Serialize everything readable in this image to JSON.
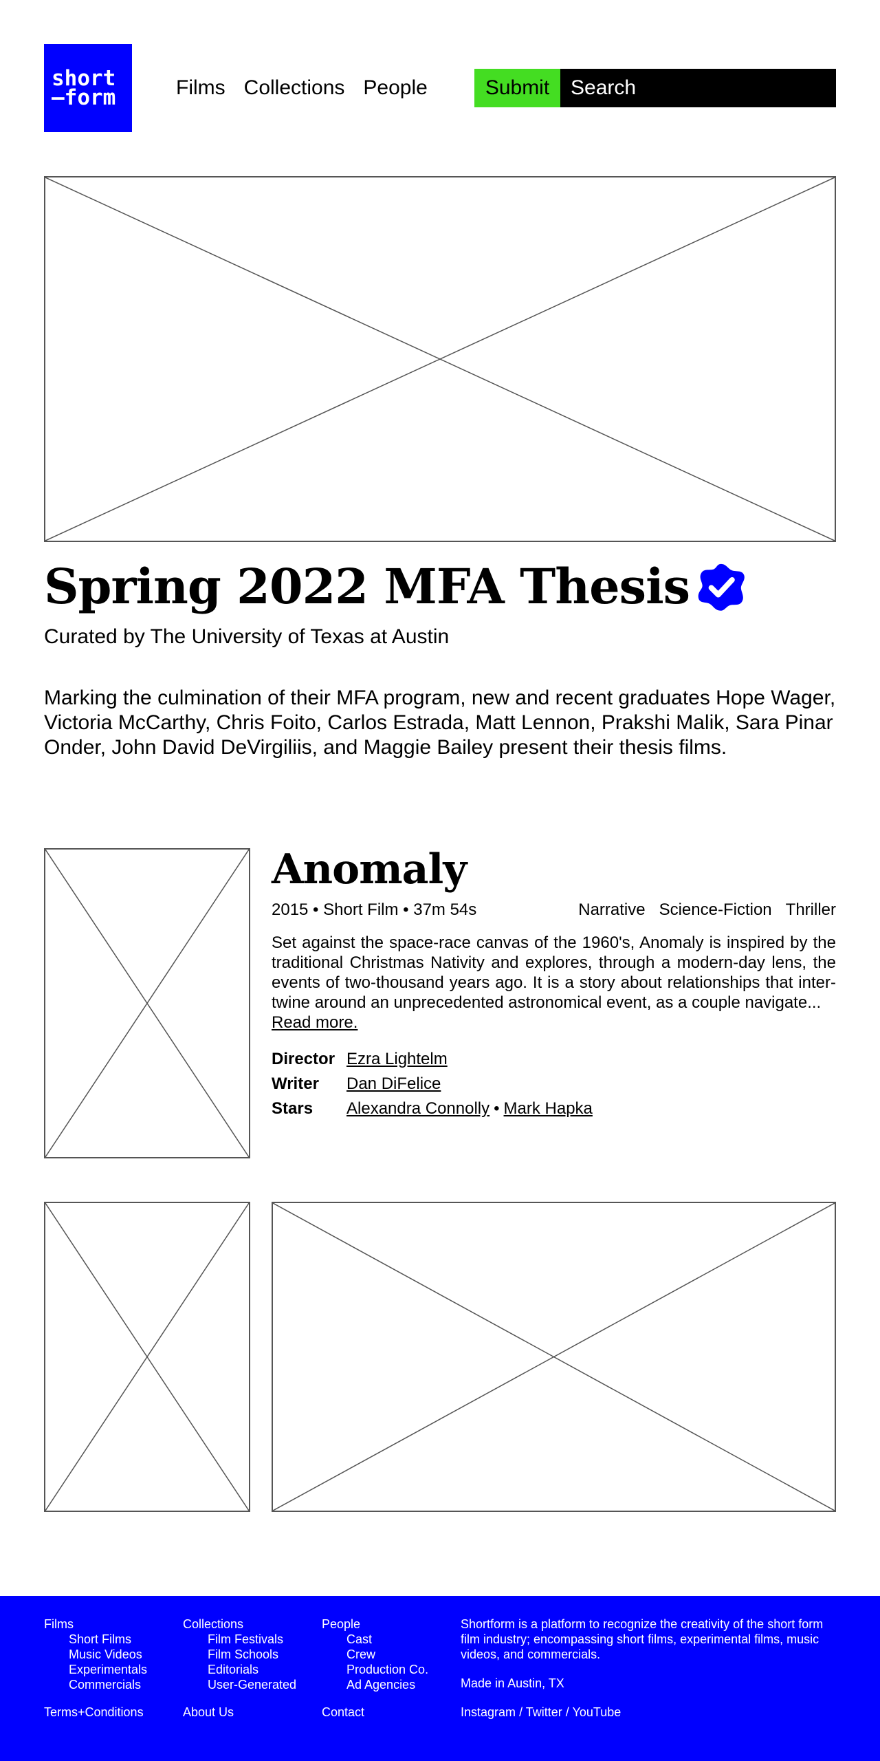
{
  "logo": {
    "line1": "short",
    "line2": "—form"
  },
  "nav": {
    "films": "Films",
    "collections": "Collections",
    "people": "People"
  },
  "search": {
    "submit_label": "Submit",
    "placeholder": "Search"
  },
  "collection": {
    "title": "Spring 2022 MFA Thesis",
    "curated_by": "Curated by The University of Texas at Austin",
    "description": "Marking the culmination of their MFA program, new and recent graduates Hope Wager, Victoria McCarthy, Chris Foito, Carlos Estrada, Matt Lennon, Prakshi Malik, Sara Pinar Onder, John David DeVirgiliis, and Maggie Bailey present their thesis films.",
    "verified_color": "#0000ff"
  },
  "film": {
    "title": "Anomaly",
    "meta": "2015 • Short Film • 37m 54s",
    "genres": [
      "Narrative",
      "Science-Fiction",
      "Thriller"
    ],
    "synopsis": "Set against the space-race canvas of the 1960's, Anomaly is inspired by the traditional Christmas Nativity and explores, through a modern-day lens, the events of two-thousand years ago. It is a story about relationships that inter-twine around an unprecedented astronomical event, as a couple navigate...",
    "read_more": "Read more.",
    "credits": {
      "director_label": "Director",
      "director": "Ezra Lightelm",
      "writer_label": "Writer",
      "writer": "Dan DiFelice",
      "stars_label": "Stars",
      "star1": "Alexandra Connolly",
      "separator": "•",
      "star2": "Mark Hapka"
    }
  },
  "footer": {
    "films": {
      "head": "Films",
      "items": [
        "Short Films",
        "Music Videos",
        "Experimentals",
        "Commercials"
      ]
    },
    "collections": {
      "head": "Collections",
      "items": [
        "Film Festivals",
        "Film Schools",
        "Editorials",
        "User-Generated"
      ]
    },
    "people": {
      "head": "People",
      "items": [
        "Cast",
        "Crew",
        "Production Co.",
        "Ad Agencies"
      ]
    },
    "terms": "Terms+Conditions",
    "about_us": "About Us",
    "contact": "Contact",
    "about_text": "Shortform is a platform to recognize the creativity of the short form film industry; encompassing short films, experimental films, music videos, and commercials.",
    "made_in_prefix": "Made in",
    "made_in_link": "Austin, TX",
    "social": {
      "instagram": "Instagram",
      "twitter": "Twitter",
      "youtube": "YouTube",
      "sep": "/"
    }
  },
  "colors": {
    "brand_blue": "#0000ff",
    "submit_green": "#44dd22"
  }
}
